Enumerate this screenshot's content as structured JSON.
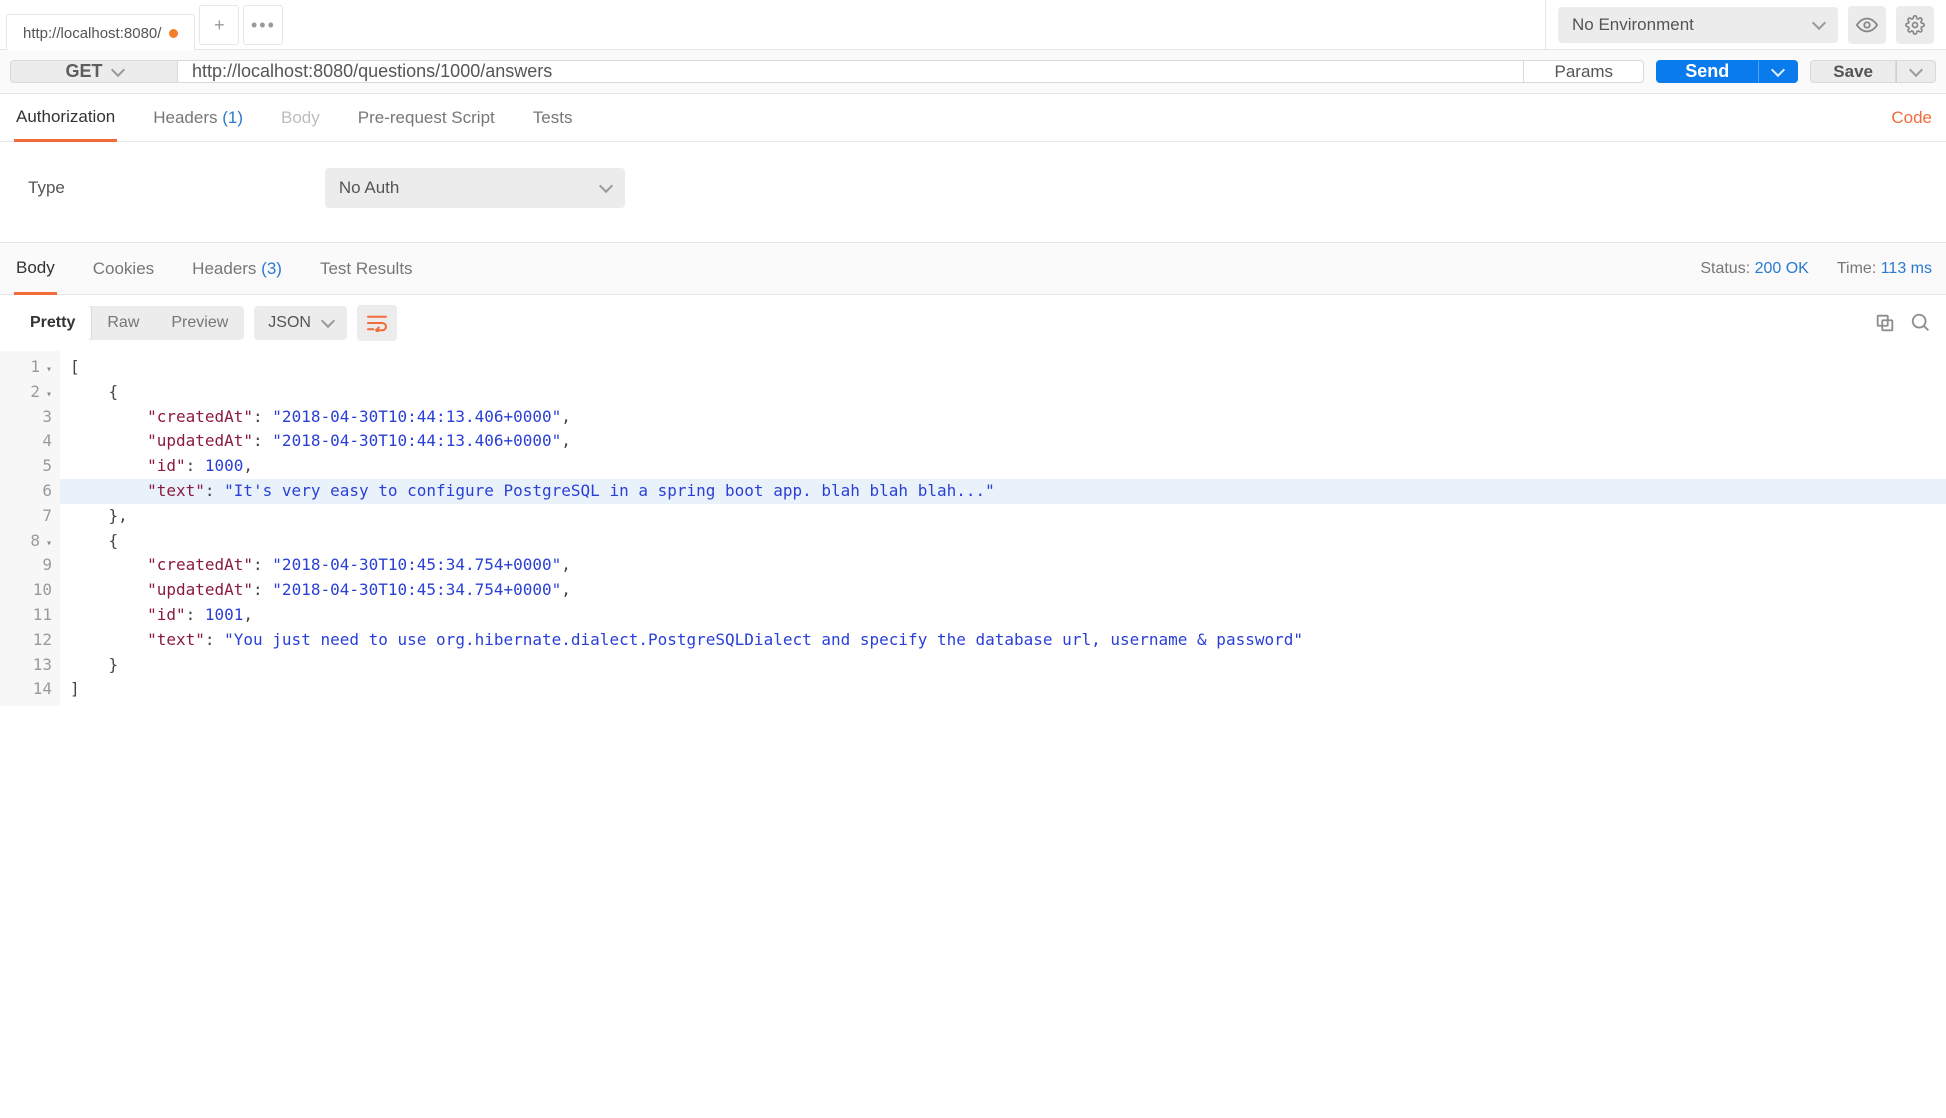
{
  "tab": {
    "title": "http://localhost:8080/"
  },
  "env": {
    "selected": "No Environment"
  },
  "request": {
    "method": "GET",
    "url": "http://localhost:8080/questions/1000/answers",
    "params_label": "Params",
    "send_label": "Send",
    "save_label": "Save"
  },
  "req_tabs": {
    "authorization": "Authorization",
    "headers": "Headers",
    "headers_count": "(1)",
    "body": "Body",
    "prerequest": "Pre-request Script",
    "tests": "Tests",
    "code_link": "Code"
  },
  "auth": {
    "type_label": "Type",
    "type_value": "No Auth"
  },
  "res_tabs": {
    "body": "Body",
    "cookies": "Cookies",
    "headers": "Headers",
    "headers_count": "(3)",
    "test_results": "Test Results"
  },
  "res_meta": {
    "status_label": "Status:",
    "status_value": "200 OK",
    "time_label": "Time:",
    "time_value": "113 ms"
  },
  "body_toolbar": {
    "pretty": "Pretty",
    "raw": "Raw",
    "preview": "Preview",
    "lang": "JSON"
  },
  "response_json": [
    {
      "createdAt": "2018-04-30T10:44:13.406+0000",
      "updatedAt": "2018-04-30T10:44:13.406+0000",
      "id": 1000,
      "text": "It's very easy to configure PostgreSQL in a spring boot app. blah blah blah..."
    },
    {
      "createdAt": "2018-04-30T10:45:34.754+0000",
      "updatedAt": "2018-04-30T10:45:34.754+0000",
      "id": 1001,
      "text": "You just need to use org.hibernate.dialect.PostgreSQLDialect and specify the database url, username & password"
    }
  ]
}
